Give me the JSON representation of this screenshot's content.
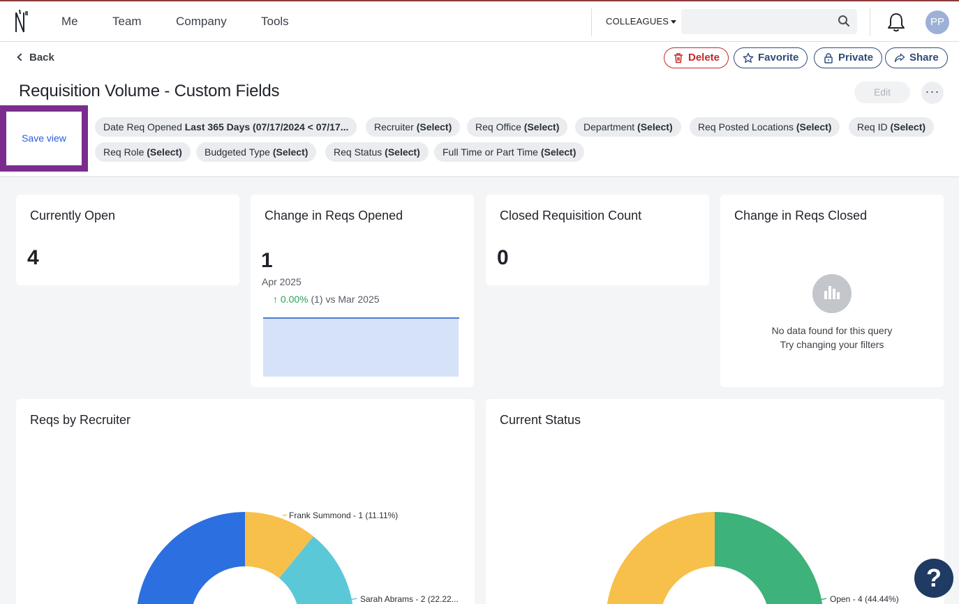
{
  "nav": {
    "items": [
      "Me",
      "Team",
      "Company",
      "Tools"
    ],
    "colleagues_label": "COLLEAGUES",
    "search_placeholder": "",
    "avatar_initials": "PP"
  },
  "header": {
    "back_label": "Back",
    "actions": {
      "delete": "Delete",
      "favorite": "Favorite",
      "private": "Private",
      "share": "Share"
    },
    "title": "Requisition Volume - Custom Fields",
    "edit_label": "Edit",
    "more_label": "···",
    "save_view_label": "Save view"
  },
  "filters": [
    {
      "name": "Date Req Opened",
      "value": "Last 365 Days (07/17/2024 < 07/17..."
    },
    {
      "name": "Recruiter",
      "value": "(Select)"
    },
    {
      "name": "Req Office",
      "value": "(Select)"
    },
    {
      "name": "Department",
      "value": "(Select)"
    },
    {
      "name": "Req Posted Locations",
      "value": "(Select)"
    },
    {
      "name": "Req ID",
      "value": "(Select)"
    },
    {
      "name": "Req Role",
      "value": "(Select)"
    },
    {
      "name": "Budgeted Type",
      "value": "(Select)"
    },
    {
      "name": "Req Status",
      "value": "(Select)"
    },
    {
      "name": "Full Time or Part Time",
      "value": "(Select)"
    }
  ],
  "cards": {
    "currently_open": {
      "title": "Currently Open",
      "value": "4"
    },
    "change_opened": {
      "title": "Change in Reqs Opened",
      "value": "1",
      "period": "Apr 2025",
      "pct": "0.00%",
      "compare": "(1) vs Mar 2025"
    },
    "closed_count": {
      "title": "Closed Requisition Count",
      "value": "0"
    },
    "change_closed": {
      "title": "Change in Reqs Closed",
      "nodata_1": "No data found for this query",
      "nodata_2": "Try changing your filters"
    },
    "by_recruiter": {
      "title": "Reqs by Recruiter",
      "label_1": "Frank Summond - 1 (11.11%)",
      "label_2": "Sarah Abrams - 2 (22.22..."
    },
    "current_status": {
      "title": "Current Status",
      "label_1": "Open - 4 (44.44%)"
    }
  },
  "colors": {
    "blue": "#2c6fe0",
    "yellow": "#f7c04a",
    "teal": "#5bc8d8",
    "green": "#3db27a",
    "accent": "#7b2d8e"
  },
  "help_label": "?"
}
